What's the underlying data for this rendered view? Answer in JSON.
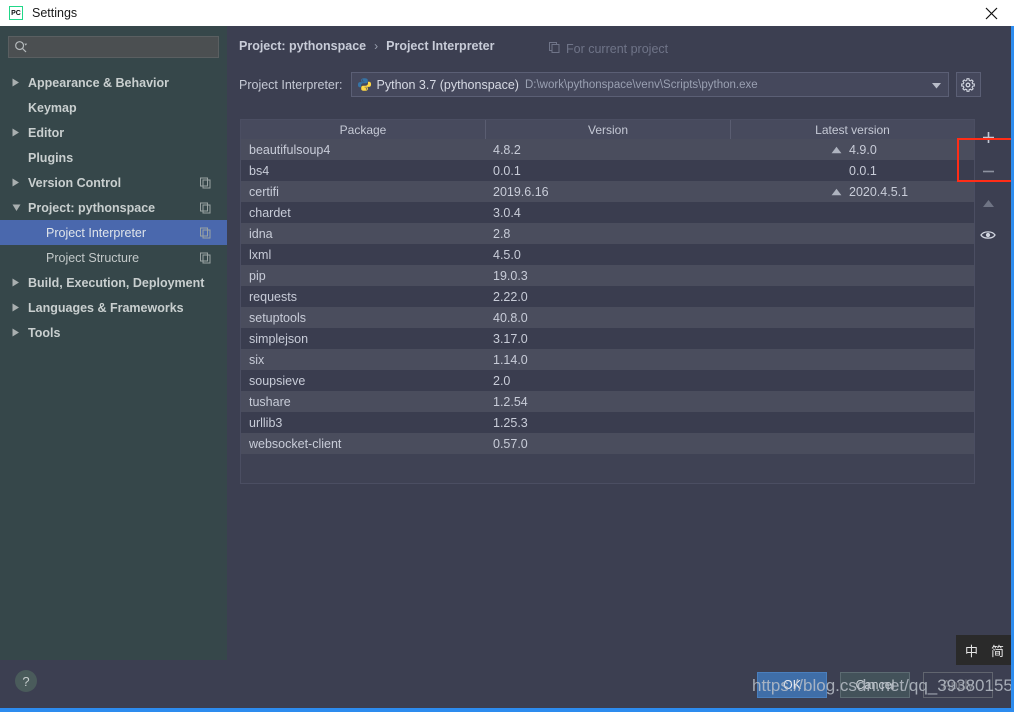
{
  "window": {
    "title": "Settings",
    "app_icon": "pycharm-icon",
    "close_icon": "close-icon"
  },
  "sidebar": {
    "search": {
      "placeholder": "",
      "value": "",
      "icon": "search-icon"
    },
    "items": [
      {
        "label": "Appearance & Behavior",
        "arrow": "collapsed",
        "bold": true,
        "indent": false,
        "copy": false,
        "selected": false
      },
      {
        "label": "Keymap",
        "arrow": "none",
        "bold": true,
        "indent": false,
        "copy": false,
        "selected": false
      },
      {
        "label": "Editor",
        "arrow": "collapsed",
        "bold": true,
        "indent": false,
        "copy": false,
        "selected": false
      },
      {
        "label": "Plugins",
        "arrow": "none",
        "bold": true,
        "indent": false,
        "copy": false,
        "selected": false
      },
      {
        "label": "Version Control",
        "arrow": "collapsed",
        "bold": true,
        "indent": false,
        "copy": true,
        "selected": false
      },
      {
        "label": "Project: pythonspace",
        "arrow": "expanded",
        "bold": true,
        "indent": false,
        "copy": true,
        "selected": false
      },
      {
        "label": "Project Interpreter",
        "arrow": "none",
        "bold": false,
        "indent": true,
        "copy": true,
        "selected": true
      },
      {
        "label": "Project Structure",
        "arrow": "none",
        "bold": false,
        "indent": true,
        "copy": true,
        "selected": false
      },
      {
        "label": "Build, Execution, Deployment",
        "arrow": "collapsed",
        "bold": true,
        "indent": false,
        "copy": false,
        "selected": false
      },
      {
        "label": "Languages & Frameworks",
        "arrow": "collapsed",
        "bold": true,
        "indent": false,
        "copy": false,
        "selected": false
      },
      {
        "label": "Tools",
        "arrow": "collapsed",
        "bold": true,
        "indent": false,
        "copy": false,
        "selected": false
      }
    ]
  },
  "content": {
    "breadcrumb": {
      "parent": "Project: pythonspace",
      "separator": "›",
      "current": "Project Interpreter"
    },
    "scope_note": {
      "icon": "copy-icon",
      "label": "For current project"
    },
    "interpreter": {
      "caption": "Project Interpreter:",
      "icon": "python-icon",
      "name": "Python 3.7 (pythonspace)",
      "path": "D:\\work\\pythonspace\\venv\\Scripts\\python.exe",
      "dropdown_icon": "chevron-down-icon",
      "settings_icon": "gear-icon"
    },
    "packages_table": {
      "columns": [
        "Package",
        "Version",
        "Latest version"
      ],
      "rows": [
        {
          "package": "beautifulsoup4",
          "version": "4.8.2",
          "latest": "4.9.0",
          "upgradable": true
        },
        {
          "package": "bs4",
          "version": "0.0.1",
          "latest": "0.0.1",
          "upgradable": false
        },
        {
          "package": "certifi",
          "version": "2019.6.16",
          "latest": "2020.4.5.1",
          "upgradable": true
        },
        {
          "package": "chardet",
          "version": "3.0.4",
          "latest": "",
          "upgradable": false
        },
        {
          "package": "idna",
          "version": "2.8",
          "latest": "",
          "upgradable": false
        },
        {
          "package": "lxml",
          "version": "4.5.0",
          "latest": "",
          "upgradable": false
        },
        {
          "package": "pip",
          "version": "19.0.3",
          "latest": "",
          "upgradable": false
        },
        {
          "package": "requests",
          "version": "2.22.0",
          "latest": "",
          "upgradable": false
        },
        {
          "package": "setuptools",
          "version": "40.8.0",
          "latest": "",
          "upgradable": false
        },
        {
          "package": "simplejson",
          "version": "3.17.0",
          "latest": "",
          "upgradable": false
        },
        {
          "package": "six",
          "version": "1.14.0",
          "latest": "",
          "upgradable": false
        },
        {
          "package": "soupsieve",
          "version": "2.0",
          "latest": "",
          "upgradable": false
        },
        {
          "package": "tushare",
          "version": "1.2.54",
          "latest": "",
          "upgradable": false
        },
        {
          "package": "urllib3",
          "version": "1.25.3",
          "latest": "",
          "upgradable": false
        },
        {
          "package": "websocket-client",
          "version": "0.57.0",
          "latest": "",
          "upgradable": false
        }
      ]
    },
    "package_toolbar": [
      {
        "icon": "plus-icon",
        "label": "+",
        "highlighted": true
      },
      {
        "icon": "minus-icon",
        "label": "–",
        "highlighted": false
      },
      {
        "icon": "upgrade-arrow-icon",
        "label": "▲",
        "highlighted": false
      },
      {
        "icon": "eye-icon",
        "label": "",
        "highlighted": false
      }
    ]
  },
  "footer": {
    "help_label": "?",
    "ok_label": "OK",
    "cancel_label": "Cancel",
    "apply_label": "Apply"
  },
  "overlay": {
    "watermark": "https://blog.csdn.net/qq_39380155",
    "ime_mode": "中",
    "ime_shape": "简"
  },
  "colors": {
    "accent_blue": "#2d8cef",
    "selection_blue": "#4a68ad",
    "sidebar_bg": "#36474a",
    "content_bg": "#3c3f51",
    "annotation_red": "#ff2d17",
    "primary_button": "#3f6ea8"
  }
}
